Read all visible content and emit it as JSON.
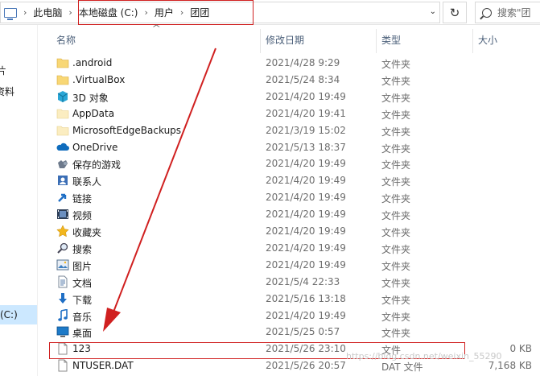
{
  "address_bar": {
    "crumbs": [
      "此电脑",
      "本地磁盘 (C:)",
      "用户",
      "团团"
    ]
  },
  "search": {
    "placeholder": "搜索\"团"
  },
  "nav": {
    "items": [
      {
        "label": "片"
      },
      {
        "label": "资料"
      },
      {
        "label": "(C:)",
        "selected": true
      },
      {
        "label": ")"
      }
    ]
  },
  "columns": {
    "name": "名称",
    "date": "修改日期",
    "type": "类型",
    "size": "大小"
  },
  "files": [
    {
      "name": ".android",
      "date": "2021/4/28 9:29",
      "type": "文件夹",
      "size": "",
      "icon": "folder-icon"
    },
    {
      "name": ".VirtualBox",
      "date": "2021/5/24 8:34",
      "type": "文件夹",
      "size": "",
      "icon": "folder-icon"
    },
    {
      "name": "3D 对象",
      "date": "2021/4/20 19:49",
      "type": "文件夹",
      "size": "",
      "icon": "3d-objects-icon"
    },
    {
      "name": "AppData",
      "date": "2021/4/20 19:41",
      "type": "文件夹",
      "size": "",
      "icon": "hidden-folder-icon"
    },
    {
      "name": "MicrosoftEdgeBackups",
      "date": "2021/3/19 15:02",
      "type": "文件夹",
      "size": "",
      "icon": "hidden-folder-icon"
    },
    {
      "name": "OneDrive",
      "date": "2021/5/13 18:37",
      "type": "文件夹",
      "size": "",
      "icon": "onedrive-icon"
    },
    {
      "name": "保存的游戏",
      "date": "2021/4/20 19:49",
      "type": "文件夹",
      "size": "",
      "icon": "saved-games-icon"
    },
    {
      "name": "联系人",
      "date": "2021/4/20 19:49",
      "type": "文件夹",
      "size": "",
      "icon": "contacts-icon"
    },
    {
      "name": "链接",
      "date": "2021/4/20 19:49",
      "type": "文件夹",
      "size": "",
      "icon": "links-icon"
    },
    {
      "name": "视频",
      "date": "2021/4/20 19:49",
      "type": "文件夹",
      "size": "",
      "icon": "videos-icon"
    },
    {
      "name": "收藏夹",
      "date": "2021/4/20 19:49",
      "type": "文件夹",
      "size": "",
      "icon": "favorites-icon"
    },
    {
      "name": "搜索",
      "date": "2021/4/20 19:49",
      "type": "文件夹",
      "size": "",
      "icon": "searches-icon"
    },
    {
      "name": "图片",
      "date": "2021/4/20 19:49",
      "type": "文件夹",
      "size": "",
      "icon": "pictures-icon"
    },
    {
      "name": "文档",
      "date": "2021/5/4 22:33",
      "type": "文件夹",
      "size": "",
      "icon": "documents-icon"
    },
    {
      "name": "下载",
      "date": "2021/5/16 13:18",
      "type": "文件夹",
      "size": "",
      "icon": "downloads-icon"
    },
    {
      "name": "音乐",
      "date": "2021/4/20 19:49",
      "type": "文件夹",
      "size": "",
      "icon": "music-icon"
    },
    {
      "name": "桌面",
      "date": "2021/5/25 0:57",
      "type": "文件夹",
      "size": "",
      "icon": "desktop-icon"
    },
    {
      "name": "123",
      "date": "2021/5/26 23:10",
      "type": "文件",
      "size": "0 KB",
      "icon": "file-icon"
    },
    {
      "name": "NTUSER.DAT",
      "date": "2021/5/26 20:57",
      "type": "DAT 文件",
      "size": "7,168 KB",
      "icon": "file-icon"
    }
  ],
  "watermark": "https://blog.csdn.net/weixin_55290"
}
